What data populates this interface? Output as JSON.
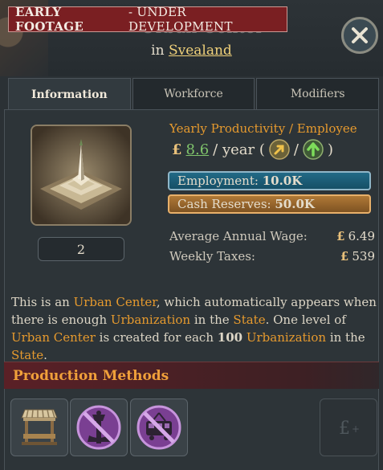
{
  "header": {
    "banner_bold": "EARLY FOOTAGE",
    "banner_rest": " - UNDER DEVELOPMENT",
    "ghost_title": "Urban Center",
    "subtitle_prefix": "in",
    "subtitle_link": "Svealand",
    "close_icon": "close-x-icon"
  },
  "tabs": [
    {
      "label": "Information",
      "active": true
    },
    {
      "label": "Workforce",
      "active": false
    },
    {
      "label": "Modifiers",
      "active": false
    }
  ],
  "building": {
    "level": "2",
    "image_icon": "urban-center-obelisk-icon"
  },
  "productivity": {
    "title": "Yearly Productivity / Employee",
    "currency": "£",
    "value": "8.6",
    "unit": "/ year (",
    "sep": "/",
    "close": ")"
  },
  "bars": {
    "employment_label": "Employment:",
    "employment_value": "10.0K",
    "cash_label": "Cash Reserves:",
    "cash_value": "50.0K"
  },
  "stats": {
    "wage_label": "Average Annual Wage:",
    "wage_currency": "£",
    "wage_value": "6.49",
    "taxes_label": "Weekly Taxes:",
    "taxes_currency": "£",
    "taxes_value": "539"
  },
  "description": {
    "p1": "This is an ",
    "h1": "Urban Center",
    "p2": ", which automatically appears when there is enough ",
    "h2": "Urbanization",
    "p3": " in the ",
    "h3": "State",
    "p4": ". One level of ",
    "h4": "Urban Center",
    "p5": " is created for each ",
    "b1": "100",
    "p6": " ",
    "h5": "Urbanization",
    "p7": " in the ",
    "h6": "State",
    "p8": "."
  },
  "production": {
    "title": "Production Methods",
    "methods": [
      {
        "icon": "market-stall-icon"
      },
      {
        "icon": "no-street-lighting-icon"
      },
      {
        "icon": "no-public-transport-icon"
      },
      {
        "icon": "add-pound-icon"
      }
    ]
  },
  "colors": {
    "accent_orange": "#e69a2e",
    "link_gold": "#f0d17a",
    "banner_red": "#7a1f22",
    "employment_blue": "#226a86",
    "cash_orange": "#b07936",
    "purple_icon": "#9b56b8"
  }
}
